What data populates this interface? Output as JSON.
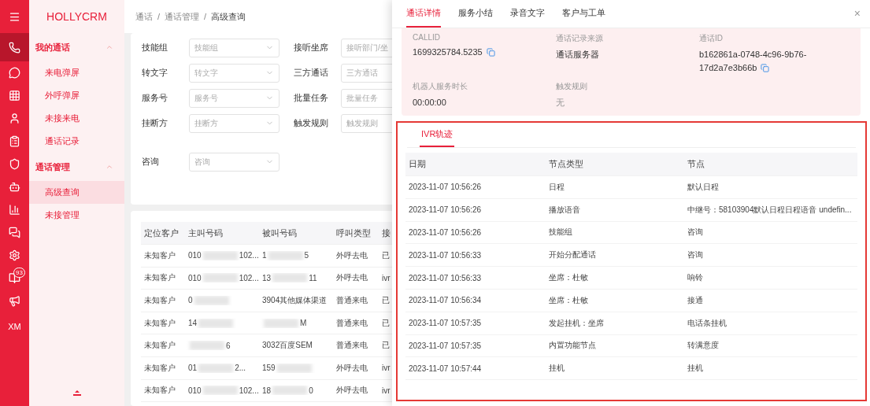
{
  "rail": {
    "items": [
      {
        "selected": false
      },
      {
        "selected": true
      },
      {
        "selected": false
      },
      {
        "selected": false
      },
      {
        "selected": false
      },
      {
        "selected": false
      },
      {
        "selected": false
      },
      {
        "selected": false
      },
      {
        "selected": false
      },
      {
        "selected": false
      },
      {
        "selected": false
      },
      {
        "selected": false,
        "badge": "93"
      },
      {
        "selected": false
      }
    ],
    "user": "XM"
  },
  "brand": "HOLLYCRM",
  "sidebar": {
    "groups": [
      {
        "label": "我的通话",
        "expanded": true,
        "items": [
          {
            "label": "来电弹屏",
            "selected": false
          },
          {
            "label": "外呼弹屏",
            "selected": false
          },
          {
            "label": "未接来电",
            "selected": false
          },
          {
            "label": "通话记录",
            "selected": false
          }
        ]
      },
      {
        "label": "通话管理",
        "expanded": true,
        "items": [
          {
            "label": "高级查询",
            "selected": true
          },
          {
            "label": "未接管理",
            "selected": false
          }
        ]
      }
    ]
  },
  "breadcrumb": {
    "items": [
      "通话",
      "通话管理",
      "高级查询"
    ],
    "separators": [
      "/",
      "/"
    ]
  },
  "filters": [
    [
      {
        "label": "技能组",
        "placeholder": "技能组",
        "kind": "select"
      },
      {
        "label": "接听坐席",
        "placeholder": "接听部门/坐",
        "kind": "input"
      }
    ],
    [
      {
        "label": "转文字",
        "placeholder": "转文字",
        "kind": "select"
      },
      {
        "label": "三方通话",
        "placeholder": "三方通话",
        "kind": "input"
      }
    ],
    [
      {
        "label": "服务号",
        "placeholder": "服务号",
        "kind": "select"
      },
      {
        "label": "批量任务",
        "placeholder": "批量任务",
        "kind": "input"
      }
    ],
    [
      {
        "label": "挂断方",
        "placeholder": "挂断方",
        "kind": "select"
      },
      {
        "label": "触发规则",
        "placeholder": "触发规则",
        "kind": "input"
      }
    ],
    [
      {
        "label": "咨询",
        "placeholder": "咨询",
        "kind": "select"
      }
    ]
  ],
  "calls": {
    "columns": [
      "定位客户",
      "主叫号码",
      "被叫号码",
      "呼叫类型",
      "接"
    ],
    "rows": [
      {
        "customer": "未知客户",
        "caller": {
          "start": "010",
          "end": "102..."
        },
        "callee": {
          "start": "1",
          "end": "5"
        },
        "type": "外呼去电",
        "column_5": "已"
      },
      {
        "customer": "未知客户",
        "caller": {
          "start": "010",
          "end": "102..."
        },
        "callee": {
          "start": "13",
          "end": "11"
        },
        "type": "外呼去电",
        "column_5": "ivr"
      },
      {
        "customer": "未知客户",
        "caller": {
          "start": "0"
        },
        "callee": {
          "full": "3904其他媒体渠道"
        },
        "type": "普通来电",
        "column_5": "已"
      },
      {
        "customer": "未知客户",
        "caller": {
          "start": "14"
        },
        "callee": {
          "end": "M"
        },
        "type": "普通来电",
        "column_5": "已"
      },
      {
        "customer": "未知客户",
        "caller": {
          "end": "6"
        },
        "callee": {
          "full": "3032百度SEM"
        },
        "type": "普通来电",
        "column_5": "已"
      },
      {
        "customer": "未知客户",
        "caller": {
          "start": "01",
          "end": "2..."
        },
        "callee": {
          "start": "159"
        },
        "type": "外呼去电",
        "column_5": "ivr"
      },
      {
        "customer": "未知客户",
        "caller": {
          "start": "010",
          "end": "102..."
        },
        "callee": {
          "start": "18",
          "end": "0"
        },
        "type": "外呼去电",
        "column_5": "ivr"
      }
    ]
  },
  "drawer": {
    "tabs": [
      {
        "label": "通话详情",
        "selected": true
      },
      {
        "label": "服务小结",
        "selected": false
      },
      {
        "label": "录音文字",
        "selected": false
      },
      {
        "label": "客户与工单",
        "selected": false
      }
    ],
    "close": "×",
    "fields": [
      {
        "label": "CALLID",
        "value": "1699325784.5235",
        "copyable": true
      },
      {
        "label": "通话记录来源",
        "value": "通话服务器",
        "copyable": false
      },
      {
        "label": "通话ID",
        "value": "b162861a-0748-4c96-9b76-17d2a7e3b66b",
        "copyable": true
      },
      {
        "label": "机器人服务时长",
        "value": "00:00:00",
        "copyable": false
      },
      {
        "label": "触发规则",
        "value": "无",
        "copyable": false,
        "muted": true
      }
    ],
    "ivr": {
      "tab": "IVR轨迹",
      "columns": [
        "日期",
        "节点类型",
        "节点"
      ],
      "rows": [
        [
          "2023-11-07 10:56:26",
          "日程",
          "默认日程"
        ],
        [
          "2023-11-07 10:56:26",
          "播放语音",
          "中继号：58103904默认日程日程语音 undefin..."
        ],
        [
          "2023-11-07 10:56:26",
          "技能组",
          "咨询"
        ],
        [
          "2023-11-07 10:56:33",
          "开始分配通话",
          "咨询"
        ],
        [
          "2023-11-07 10:56:33",
          "坐席：杜敏",
          "响铃"
        ],
        [
          "2023-11-07 10:56:34",
          "坐席：杜敏",
          "接通"
        ],
        [
          "2023-11-07 10:57:35",
          "发起挂机：坐席",
          "电话条挂机"
        ],
        [
          "2023-11-07 10:57:35",
          "内置功能节点",
          "转满意度"
        ],
        [
          "2023-11-07 10:57:44",
          "挂机",
          "挂机"
        ]
      ]
    }
  }
}
